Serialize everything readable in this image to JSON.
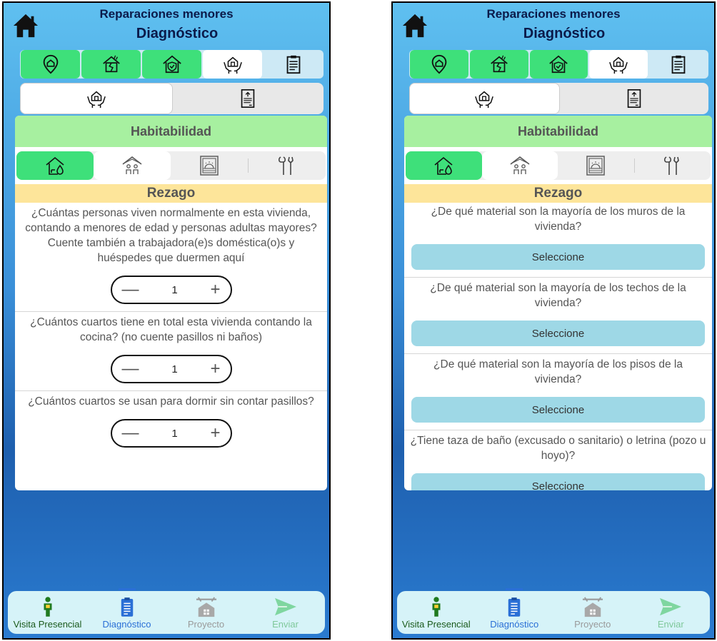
{
  "app": {
    "title": "Reparaciones menores",
    "subtitle": "Diagnóstico"
  },
  "categories": [
    {
      "icon": "location-home-icon",
      "active": true
    },
    {
      "icon": "broken-house-icon",
      "active": true
    },
    {
      "icon": "house-shield-icon",
      "active": true
    },
    {
      "icon": "hands-house-icon",
      "active": false,
      "selected": true
    },
    {
      "icon": "clipboard-icon",
      "active": false
    }
  ],
  "subcategories": [
    {
      "icon": "hands-house-icon",
      "selected": true
    },
    {
      "icon": "house-plan-icon",
      "selected": false
    }
  ],
  "section": {
    "title": "Habitabilidad"
  },
  "section_tabs": [
    {
      "icon": "house-water-icon",
      "state": "green"
    },
    {
      "icon": "family-house-icon",
      "state": "white"
    },
    {
      "icon": "window-icon",
      "state": "plain"
    },
    {
      "icon": "tools-icon",
      "state": "plain"
    }
  ],
  "panel": {
    "title": "Rezago"
  },
  "left_questions": [
    {
      "text": "¿Cuántas personas viven normalmente en esta vivienda, contando a menores de edad y personas adultas mayores? Cuente también a trabajadora(e)s doméstica(o)s y huéspedes que duermen aquí",
      "value": "1"
    },
    {
      "text": "¿Cuántos cuartos tiene en total esta vivienda contando la cocina? (no cuente pasillos ni baños)",
      "value": "1"
    },
    {
      "text": "¿Cuántos cuartos se usan para dormir sin contar pasillos?",
      "value": "1"
    }
  ],
  "right_questions": [
    {
      "text": "¿De qué material son la mayoría de los muros de la vivienda?",
      "button": "Seleccione"
    },
    {
      "text": "¿De qué material son la mayoría de los techos de la vivienda?",
      "button": "Seleccione"
    },
    {
      "text": "¿De qué material son la mayoría de los pisos de la vivienda?",
      "button": "Seleccione"
    },
    {
      "text": "¿Tiene taza de baño (excusado o sanitario) o letrina (pozo u hoyo)?",
      "button": "Seleccione"
    }
  ],
  "stepper": {
    "minus": "—",
    "plus": "+"
  },
  "bottom_nav": [
    {
      "label": "Visita Presencial",
      "icon": "person-icon",
      "color": "#1a7a1a"
    },
    {
      "label": "Diagnóstico",
      "icon": "clipboard-list-icon",
      "color": "#2a6fd6",
      "active": true
    },
    {
      "label": "Proyecto",
      "icon": "house-tools-icon",
      "color": "#9a9a9a"
    },
    {
      "label": "Enviar",
      "icon": "send-icon",
      "color": "#7fd6a0"
    }
  ],
  "colors": {
    "green": "#3ee07a",
    "header_green": "#a7f0a0",
    "rezago": "#fde59a",
    "select": "#9ed8e6"
  }
}
